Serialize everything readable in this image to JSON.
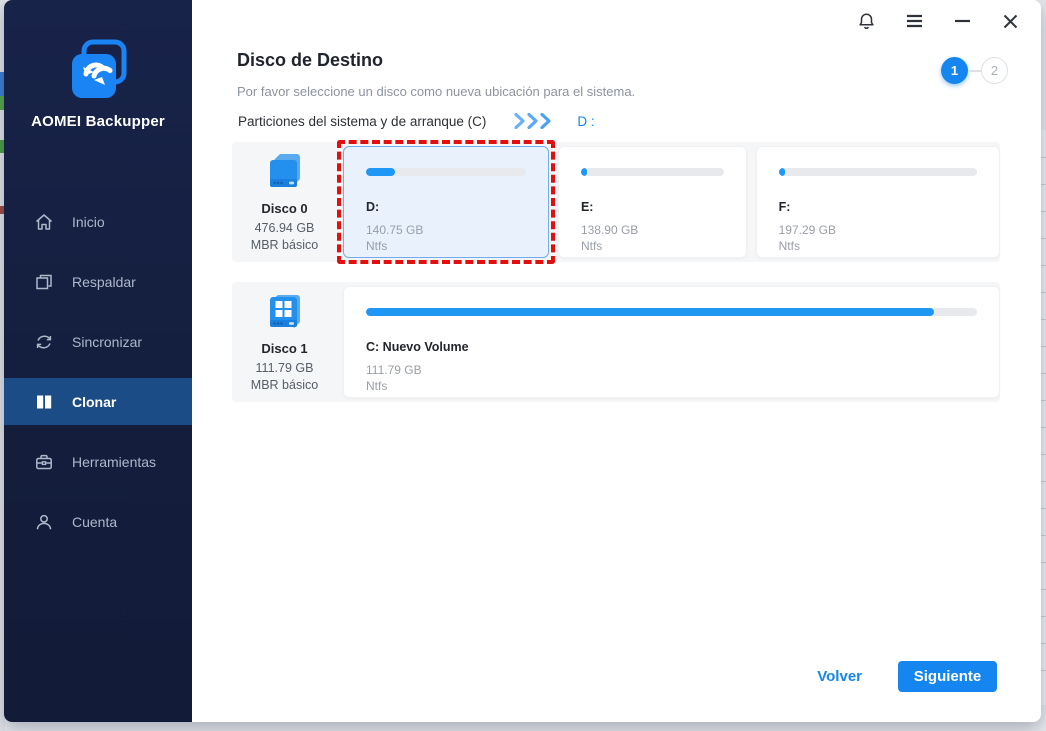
{
  "titlebar": {
    "icons": [
      {
        "name": "bell"
      },
      {
        "name": "menu"
      },
      {
        "name": "minimize"
      },
      {
        "name": "close"
      }
    ]
  },
  "sidebar": {
    "brand": "AOMEI Backupper",
    "items": [
      {
        "label": "Inicio",
        "icon": "home-icon",
        "active": false
      },
      {
        "label": "Respaldar",
        "icon": "copy-icon",
        "active": false
      },
      {
        "label": "Sincronizar",
        "icon": "sync-icon",
        "active": false
      },
      {
        "label": "Clonar",
        "icon": "clone-icon",
        "active": true
      },
      {
        "label": "Herramientas",
        "icon": "toolbox-icon",
        "active": false
      },
      {
        "label": "Cuenta",
        "icon": "user-icon",
        "active": false
      }
    ]
  },
  "header": {
    "title": "Disco de Destino",
    "subtitle": "Por favor seleccione un disco como nueva ubicación para el sistema.",
    "steps": {
      "step1": "1",
      "step2": "2",
      "current": "1"
    }
  },
  "selection_line": {
    "source": "Particiones del sistema y de arranque (C)",
    "target": "D :"
  },
  "disks": [
    {
      "name": "Disco 0",
      "size": "476.94 GB",
      "type": "MBR básico",
      "partitions": [
        {
          "label": "D:",
          "size": "140.75 GB",
          "fs": "Ntfs",
          "used_percent": 18,
          "selected": true
        },
        {
          "label": "E:",
          "size": "138.90 GB",
          "fs": "Ntfs",
          "used_percent": 2,
          "selected": false
        },
        {
          "label": "F:",
          "size": "197.29 GB",
          "fs": "Ntfs",
          "used_percent": 2,
          "selected": false
        }
      ]
    },
    {
      "name": "Disco 1",
      "size": "111.79 GB",
      "type": "MBR básico",
      "partitions": [
        {
          "label": "C: Nuevo Volume",
          "size": "111.79 GB",
          "fs": "Ntfs",
          "used_percent": 93,
          "selected": false
        }
      ]
    }
  ],
  "footer": {
    "back_label": "Volver",
    "next_label": "Siguiente"
  },
  "colors": {
    "accent_blue": "#1586f0",
    "progress_blue": "#1e97f5",
    "sidebar_bg": "#15203d",
    "active_item_bg": "#1c4c86",
    "selection_dashed_red": "#e30e0e",
    "selected_card_bg": "#e8f1fc",
    "row_bg": "#f5f6f8"
  }
}
